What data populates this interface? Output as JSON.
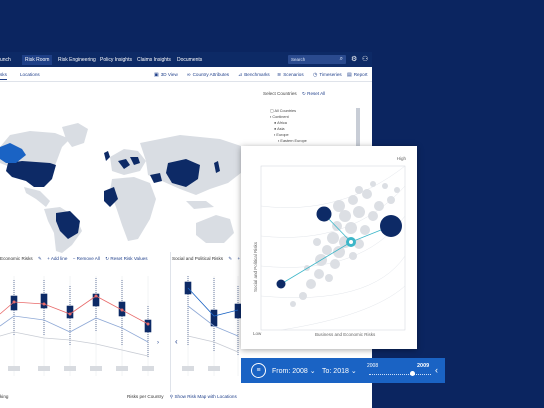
{
  "topnav": {
    "brand": "unch",
    "items": [
      {
        "label": "Risk Room",
        "active": true
      },
      {
        "label": "Risk Engineering",
        "active": false
      },
      {
        "label": "Policy Insights",
        "active": false
      },
      {
        "label": "Claims Insights",
        "active": false
      },
      {
        "label": "Documents",
        "active": false
      }
    ],
    "search_placeholder": "Search"
  },
  "subnav": {
    "tabs": [
      {
        "label": "sks",
        "active": true
      },
      {
        "label": "Locations",
        "active": false
      }
    ],
    "tools": [
      {
        "label": "3D View",
        "icon": "cube-icon"
      },
      {
        "label": "Country Attributes",
        "icon": "link-icon"
      },
      {
        "label": "Benchmarks",
        "icon": "chart-icon"
      },
      {
        "label": "Scenarios",
        "icon": "layers-icon"
      },
      {
        "label": "Timeseries",
        "icon": "clock-icon"
      },
      {
        "label": "Report",
        "icon": "report-icon"
      }
    ]
  },
  "countries": {
    "title": "Select Countries",
    "reset": "Reset All",
    "tree": [
      "All Countries",
      "Continent",
      "Africa",
      "Asia",
      "Europe",
      "Eastern Europe"
    ]
  },
  "panels": {
    "economic": {
      "title": "Economic Risks",
      "add": "+ Add line",
      "remove": "Remove All",
      "reset": "Reset Risk Values"
    },
    "social": {
      "title": "Social and Political Risks"
    }
  },
  "bottom": {
    "left": "king",
    "right": "Risks per Country",
    "link": "Show Risk Map with Locations"
  },
  "scatter": {
    "high_label": "High",
    "low_label": "Low",
    "xlabel": "Business and Economic Risks",
    "ylabel": "Social and Political Risks"
  },
  "timeline": {
    "from_label": "From:",
    "from_value": "2008",
    "to_label": "To:",
    "to_value": "2018",
    "start_year": "2008",
    "current_year": "2009"
  },
  "colors": {
    "background": "#0b2560",
    "navbar": "#0d2a66",
    "accent": "#1a63c4",
    "map_highlight": "#0d2a66",
    "map_selected": "#1a63c4",
    "scatter_point": "#d8dbe0",
    "teal": "#3bb6c8"
  }
}
